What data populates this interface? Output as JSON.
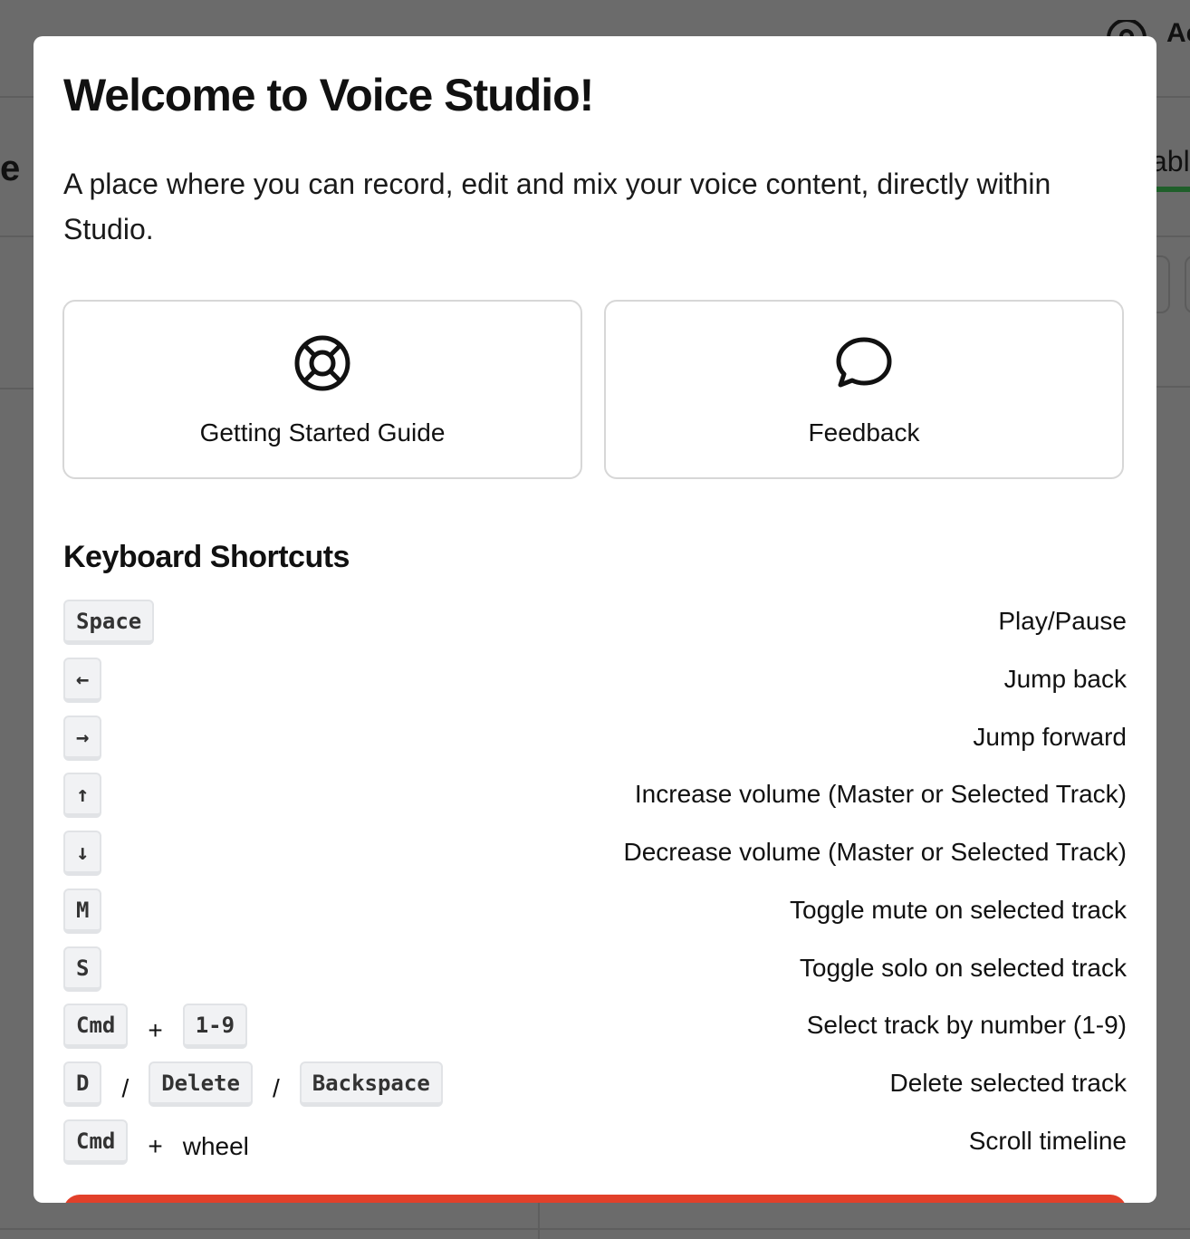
{
  "background": {
    "left_fragment": "e",
    "right_fragment": "abl",
    "top_right_fragment": "Ac"
  },
  "modal": {
    "title": "Welcome to Voice Studio!",
    "intro": "A place where you can record, edit and mix your voice content, directly within Studio.",
    "cards": [
      {
        "label": "Getting Started Guide",
        "icon": "lifebuoy-icon"
      },
      {
        "label": "Feedback",
        "icon": "chat-bubble-icon"
      }
    ],
    "shortcuts_title": "Keyboard Shortcuts",
    "shortcuts": [
      {
        "keys": [
          "Space"
        ],
        "desc": "Play/Pause"
      },
      {
        "keys": [
          "←"
        ],
        "desc": "Jump back"
      },
      {
        "keys": [
          "→"
        ],
        "desc": "Jump forward"
      },
      {
        "keys": [
          "↑"
        ],
        "desc": "Increase volume (Master or Selected Track)"
      },
      {
        "keys": [
          "↓"
        ],
        "desc": "Decrease volume (Master or Selected Track)"
      },
      {
        "keys": [
          "M"
        ],
        "desc": "Toggle mute on selected track"
      },
      {
        "keys": [
          "S"
        ],
        "desc": "Toggle solo on selected track"
      },
      {
        "keys": [
          "Cmd",
          "1-9"
        ],
        "joiner": "+",
        "desc": "Select track by number (1-9)"
      },
      {
        "keys": [
          "D",
          "Delete",
          "Backspace"
        ],
        "joiner": "/",
        "desc": "Delete selected track"
      },
      {
        "keys": [
          "Cmd"
        ],
        "joiner": "+",
        "suffix": "wheel",
        "desc": "Scroll timeline"
      }
    ]
  },
  "colors": {
    "overlay": "#6b6b6b",
    "accent": "#e2402a",
    "green": "#1f5f2a"
  }
}
